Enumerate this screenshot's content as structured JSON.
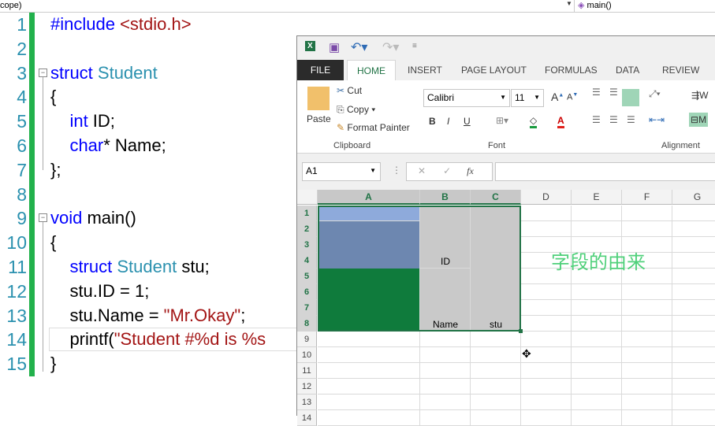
{
  "editor": {
    "scope_label": "cope)",
    "function_dropdown": "main()",
    "line_numbers": [
      "1",
      "2",
      "3",
      "4",
      "5",
      "6",
      "7",
      "8",
      "9",
      "10",
      "11",
      "12",
      "13",
      "14",
      "15"
    ],
    "lines": [
      [
        {
          "t": "#include ",
          "c": "kw"
        },
        {
          "t": "<stdio.h>",
          "c": "st"
        }
      ],
      [],
      [
        {
          "t": "struct ",
          "c": "kw"
        },
        {
          "t": "Student",
          "c": "ty"
        }
      ],
      [
        {
          "t": "{",
          "c": ""
        }
      ],
      [
        {
          "t": "    int ",
          "c": "kw"
        },
        {
          "t": "ID;",
          "c": ""
        }
      ],
      [
        {
          "t": "    char",
          "c": "kw"
        },
        {
          "t": "* Name;",
          "c": ""
        }
      ],
      [
        {
          "t": "};",
          "c": ""
        }
      ],
      [],
      [
        {
          "t": "void ",
          "c": "kw"
        },
        {
          "t": "main()",
          "c": ""
        }
      ],
      [
        {
          "t": "{",
          "c": ""
        }
      ],
      [
        {
          "t": "    struct ",
          "c": "kw"
        },
        {
          "t": "Student",
          "c": "ty"
        },
        {
          "t": " stu;",
          "c": ""
        }
      ],
      [
        {
          "t": "    stu.ID = 1;",
          "c": ""
        }
      ],
      [
        {
          "t": "    stu.Name = ",
          "c": ""
        },
        {
          "t": "\"Mr.Okay\"",
          "c": "st"
        },
        {
          "t": ";",
          "c": ""
        }
      ],
      [
        {
          "t": "    printf(",
          "c": ""
        },
        {
          "t": "\"Student #%d is %s",
          "c": "st"
        }
      ],
      [
        {
          "t": "}",
          "c": ""
        }
      ]
    ]
  },
  "excel": {
    "tabs": [
      "FILE",
      "HOME",
      "INSERT",
      "PAGE LAYOUT",
      "FORMULAS",
      "DATA",
      "REVIEW"
    ],
    "active_tab": "HOME",
    "clipboard": {
      "paste": "Paste",
      "cut": "Cut",
      "copy": "Copy",
      "format_painter": "Format Painter",
      "group": "Clipboard"
    },
    "font": {
      "name": "Calibri",
      "size": "11",
      "bold": "B",
      "italic": "I",
      "underline": "U",
      "group": "Font"
    },
    "alignment": {
      "group": "Alignment",
      "wrap": "W",
      "merge": "M"
    },
    "name_box": "A1",
    "fx": "fx",
    "columns": [
      "A",
      "B",
      "C",
      "D",
      "E",
      "F",
      "G"
    ],
    "rows": [
      "1",
      "2",
      "3",
      "4",
      "5",
      "6",
      "7",
      "8",
      "9",
      "10",
      "11",
      "12",
      "13",
      "14"
    ],
    "cells": {
      "B4": "ID",
      "B8": "Name",
      "C8": "stu"
    },
    "annotation": "字段的由来",
    "colors": {
      "a1": "#8eaadb",
      "a2_a4": "#6d87b0",
      "a5_a8": "#0f7b3c",
      "selection_gray": "#c9c9c9",
      "annotation": "#4fd07a",
      "excel_green": "#217346"
    }
  }
}
